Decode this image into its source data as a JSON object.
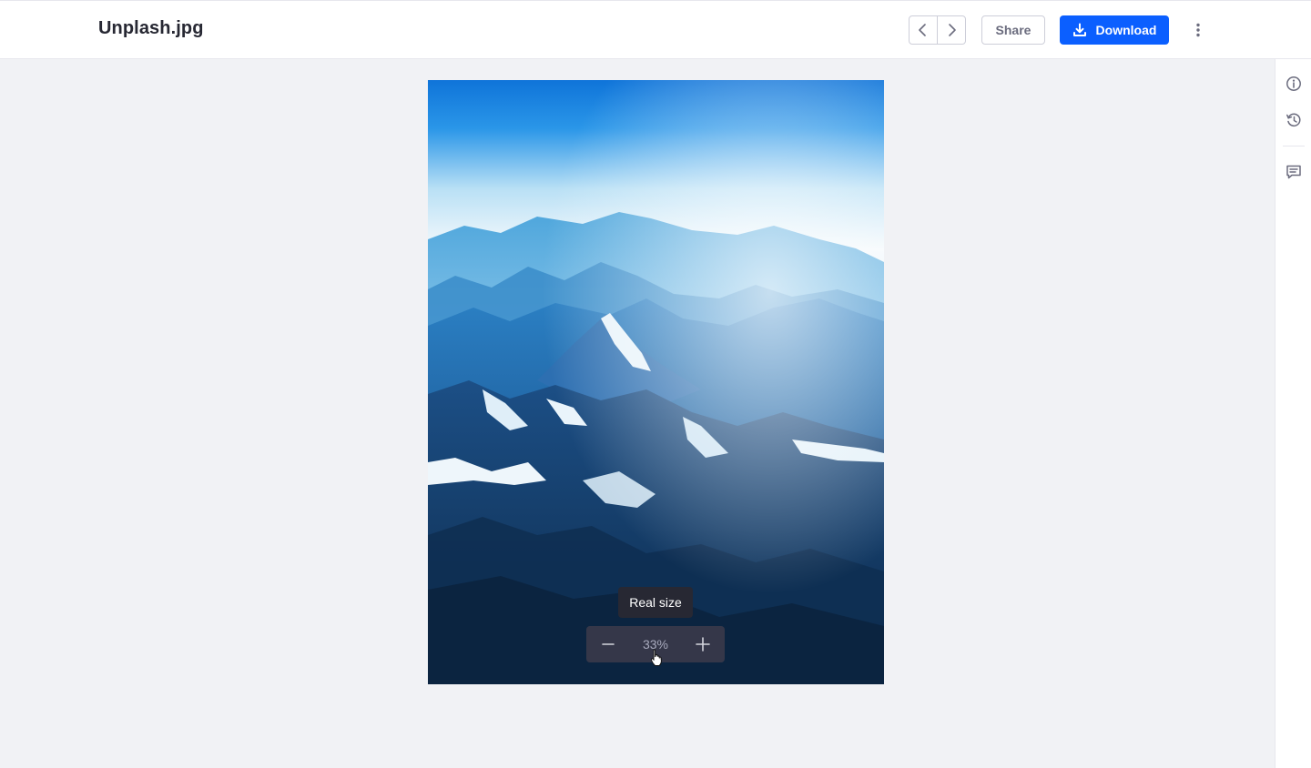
{
  "header": {
    "title": "Unplash.jpg",
    "prev_icon": "chevron-left-icon",
    "next_icon": "chevron-right-icon",
    "share_label": "Share",
    "download_label": "Download",
    "download_icon": "download-icon",
    "more_icon": "ellipsis-v-icon"
  },
  "sidebar": {
    "icons": [
      "info-circle-icon",
      "history-icon",
      "comments-icon"
    ]
  },
  "preview": {
    "image_description": "aerial view of snowy blue mountain ranges",
    "tooltip": "Real size",
    "zoom": {
      "value": "33%",
      "zoom_out_icon": "minus-icon",
      "zoom_in_icon": "plus-icon"
    }
  },
  "colors": {
    "primary": "#0b5fff",
    "text": "#272833",
    "background": "#f1f2f5"
  }
}
